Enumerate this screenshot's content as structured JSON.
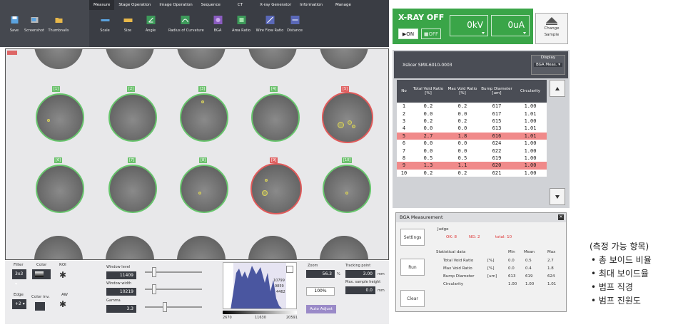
{
  "menu": [
    "Measure",
    "Stage Operation",
    "Image Operation",
    "Sequence",
    "CT",
    "X-ray Generator",
    "Information",
    "Manage"
  ],
  "tools": [
    {
      "label": "Save",
      "icon": "save-icon"
    },
    {
      "label": "Screenshot",
      "icon": "screenshot-icon"
    },
    {
      "label": "Thumbnails",
      "icon": "folder-icon"
    },
    {
      "label": "Scale",
      "icon": "scale-icon"
    },
    {
      "label": "Size",
      "icon": "size-icon"
    },
    {
      "label": "Angle",
      "icon": "angle-icon"
    },
    {
      "label": "Radius of Curvature",
      "icon": "curvature-icon"
    },
    {
      "label": "BGA",
      "icon": "bga-icon"
    },
    {
      "label": "Area Ratio",
      "icon": "area-ratio-icon"
    },
    {
      "label": "Wire Flow Ratio",
      "icon": "wire-flow-icon"
    },
    {
      "label": "Distance",
      "icon": "distance-icon"
    }
  ],
  "xray": {
    "title": "X-RAY OFF",
    "on": "▶ON",
    "off": "■OFF",
    "kv": "0kV",
    "ua": "0uA"
  },
  "change_sample": [
    "Change",
    "Sample"
  ],
  "bumps": [
    "[1]",
    "[2]",
    "[3]",
    "[4]",
    "[5]",
    "[6]",
    "[7]",
    "[8]",
    "[9]",
    "[10]"
  ],
  "results": {
    "name": "Xslicer SMX-6010-0003",
    "display_label": "Display",
    "display_value": "BGA Meas. ▾",
    "columns": [
      "No",
      "Total Void Ratio [%]",
      "Max Void Ratio [%]",
      "Bump Diameter [um]",
      "Circularity"
    ],
    "rows": [
      [
        "1",
        "0.2",
        "0.2",
        "617",
        "1.00"
      ],
      [
        "2",
        "0.0",
        "0.0",
        "617",
        "1.01"
      ],
      [
        "3",
        "0.2",
        "0.2",
        "615",
        "1.00"
      ],
      [
        "4",
        "0.0",
        "0.0",
        "613",
        "1.01"
      ],
      [
        "5",
        "2.7",
        "1.8",
        "616",
        "1.01"
      ],
      [
        "6",
        "0.0",
        "0.0",
        "624",
        "1.00"
      ],
      [
        "7",
        "0.0",
        "0.0",
        "622",
        "1.00"
      ],
      [
        "8",
        "0.5",
        "0.5",
        "619",
        "1.00"
      ],
      [
        "9",
        "1.3",
        "1.1",
        "620",
        "1.00"
      ],
      [
        "10",
        "0.2",
        "0.2",
        "621",
        "1.00"
      ]
    ],
    "ng_rows": [
      5,
      9
    ]
  },
  "bga": {
    "title": "BGA Measurement",
    "settings": "Settings",
    "run": "Run",
    "clear": "Clear",
    "judge": "Judge",
    "ok": "OK: 8",
    "ng": "NG: 2",
    "total": "total: 10",
    "stat_title": "Statistical data",
    "stat_cols": [
      "Min",
      "Mean",
      "Max"
    ],
    "stats": [
      {
        "name": "Total Void Ratio",
        "unit": "[%]",
        "min": "0.0",
        "mean": "0.5",
        "max": "2.7"
      },
      {
        "name": "Max Void Ratio",
        "unit": "[%]",
        "min": "0.0",
        "mean": "0.4",
        "max": "1.8"
      },
      {
        "name": "Bump Diameter",
        "unit": "[um]",
        "min": "613",
        "mean": "619",
        "max": "624"
      },
      {
        "name": "Circularity",
        "unit": "",
        "min": "1.00",
        "mean": "1.00",
        "max": "1.01"
      }
    ]
  },
  "controls": {
    "filter": "Filter",
    "filter_val": "3x3 ▾",
    "color": "Color",
    "roi": "ROI",
    "edge": "Edge",
    "edge_val": "+2 ▾",
    "color_inv": "Color inv.",
    "aw": "AW",
    "window_level": "Window level",
    "window_level_val": "11409",
    "window_width": "Window width",
    "window_width_val": "10219",
    "gamma": "Gamma",
    "gamma_val": "3.3",
    "zoom": "Zoom",
    "zoom_val": "56.3",
    "zoom_unit": "%",
    "zoom_100": "100%",
    "auto_adjust": "Auto Adjust",
    "tracking": "Tracking point",
    "tracking_val": "3.00",
    "tracking_unit": "mm",
    "max_height": "Max. sample height",
    "max_height_val": "0.0",
    "max_height_unit": "mm",
    "hist_min": "2670",
    "hist_mid": "11630",
    "hist_max": "20591",
    "hist_top": "10799",
    "hist_mid2": "9859",
    "hist_low": "4462"
  },
  "notes": [
    "(측정 가능 항목)",
    "• 총 보이드 비율",
    "• 최대 보이드율",
    "• 범프 직경",
    "• 범프 진원도"
  ]
}
